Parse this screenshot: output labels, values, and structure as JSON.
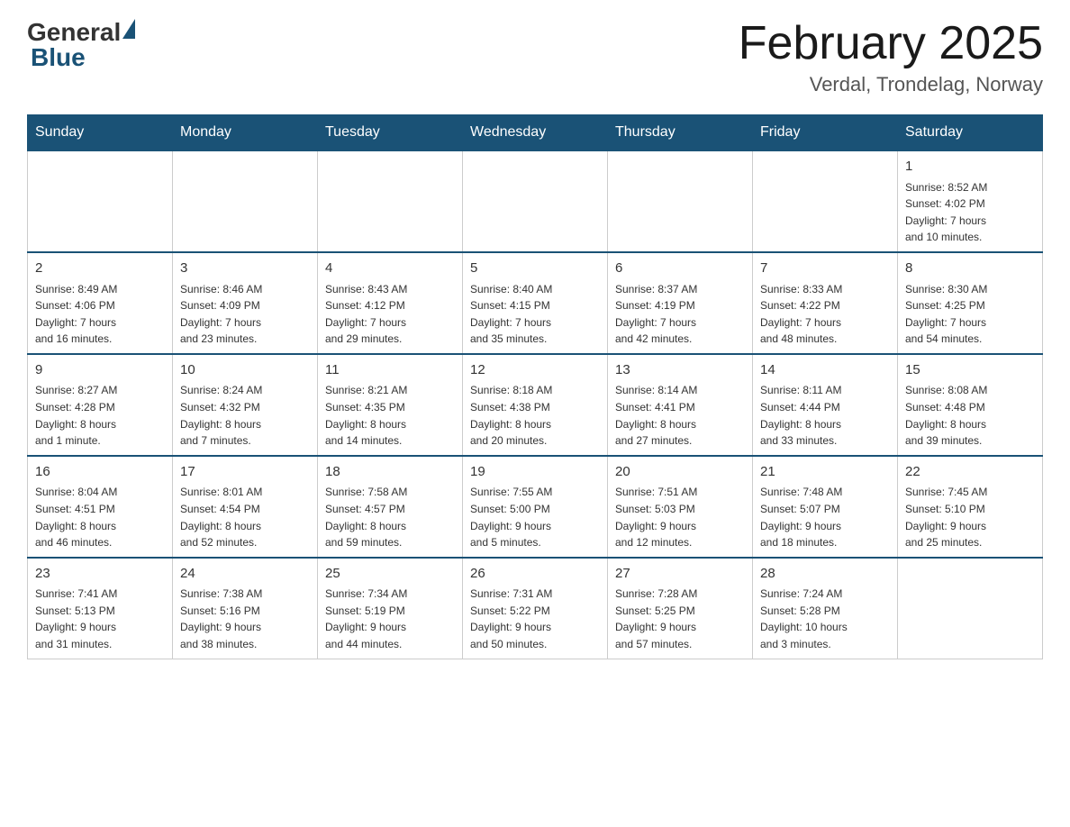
{
  "header": {
    "title": "February 2025",
    "subtitle": "Verdal, Trondelag, Norway",
    "logo": {
      "general": "General",
      "blue": "Blue"
    }
  },
  "weekdays": [
    "Sunday",
    "Monday",
    "Tuesday",
    "Wednesday",
    "Thursday",
    "Friday",
    "Saturday"
  ],
  "weeks": [
    [
      {
        "day": "",
        "info": ""
      },
      {
        "day": "",
        "info": ""
      },
      {
        "day": "",
        "info": ""
      },
      {
        "day": "",
        "info": ""
      },
      {
        "day": "",
        "info": ""
      },
      {
        "day": "",
        "info": ""
      },
      {
        "day": "1",
        "info": "Sunrise: 8:52 AM\nSunset: 4:02 PM\nDaylight: 7 hours\nand 10 minutes."
      }
    ],
    [
      {
        "day": "2",
        "info": "Sunrise: 8:49 AM\nSunset: 4:06 PM\nDaylight: 7 hours\nand 16 minutes."
      },
      {
        "day": "3",
        "info": "Sunrise: 8:46 AM\nSunset: 4:09 PM\nDaylight: 7 hours\nand 23 minutes."
      },
      {
        "day": "4",
        "info": "Sunrise: 8:43 AM\nSunset: 4:12 PM\nDaylight: 7 hours\nand 29 minutes."
      },
      {
        "day": "5",
        "info": "Sunrise: 8:40 AM\nSunset: 4:15 PM\nDaylight: 7 hours\nand 35 minutes."
      },
      {
        "day": "6",
        "info": "Sunrise: 8:37 AM\nSunset: 4:19 PM\nDaylight: 7 hours\nand 42 minutes."
      },
      {
        "day": "7",
        "info": "Sunrise: 8:33 AM\nSunset: 4:22 PM\nDaylight: 7 hours\nand 48 minutes."
      },
      {
        "day": "8",
        "info": "Sunrise: 8:30 AM\nSunset: 4:25 PM\nDaylight: 7 hours\nand 54 minutes."
      }
    ],
    [
      {
        "day": "9",
        "info": "Sunrise: 8:27 AM\nSunset: 4:28 PM\nDaylight: 8 hours\nand 1 minute."
      },
      {
        "day": "10",
        "info": "Sunrise: 8:24 AM\nSunset: 4:32 PM\nDaylight: 8 hours\nand 7 minutes."
      },
      {
        "day": "11",
        "info": "Sunrise: 8:21 AM\nSunset: 4:35 PM\nDaylight: 8 hours\nand 14 minutes."
      },
      {
        "day": "12",
        "info": "Sunrise: 8:18 AM\nSunset: 4:38 PM\nDaylight: 8 hours\nand 20 minutes."
      },
      {
        "day": "13",
        "info": "Sunrise: 8:14 AM\nSunset: 4:41 PM\nDaylight: 8 hours\nand 27 minutes."
      },
      {
        "day": "14",
        "info": "Sunrise: 8:11 AM\nSunset: 4:44 PM\nDaylight: 8 hours\nand 33 minutes."
      },
      {
        "day": "15",
        "info": "Sunrise: 8:08 AM\nSunset: 4:48 PM\nDaylight: 8 hours\nand 39 minutes."
      }
    ],
    [
      {
        "day": "16",
        "info": "Sunrise: 8:04 AM\nSunset: 4:51 PM\nDaylight: 8 hours\nand 46 minutes."
      },
      {
        "day": "17",
        "info": "Sunrise: 8:01 AM\nSunset: 4:54 PM\nDaylight: 8 hours\nand 52 minutes."
      },
      {
        "day": "18",
        "info": "Sunrise: 7:58 AM\nSunset: 4:57 PM\nDaylight: 8 hours\nand 59 minutes."
      },
      {
        "day": "19",
        "info": "Sunrise: 7:55 AM\nSunset: 5:00 PM\nDaylight: 9 hours\nand 5 minutes."
      },
      {
        "day": "20",
        "info": "Sunrise: 7:51 AM\nSunset: 5:03 PM\nDaylight: 9 hours\nand 12 minutes."
      },
      {
        "day": "21",
        "info": "Sunrise: 7:48 AM\nSunset: 5:07 PM\nDaylight: 9 hours\nand 18 minutes."
      },
      {
        "day": "22",
        "info": "Sunrise: 7:45 AM\nSunset: 5:10 PM\nDaylight: 9 hours\nand 25 minutes."
      }
    ],
    [
      {
        "day": "23",
        "info": "Sunrise: 7:41 AM\nSunset: 5:13 PM\nDaylight: 9 hours\nand 31 minutes."
      },
      {
        "day": "24",
        "info": "Sunrise: 7:38 AM\nSunset: 5:16 PM\nDaylight: 9 hours\nand 38 minutes."
      },
      {
        "day": "25",
        "info": "Sunrise: 7:34 AM\nSunset: 5:19 PM\nDaylight: 9 hours\nand 44 minutes."
      },
      {
        "day": "26",
        "info": "Sunrise: 7:31 AM\nSunset: 5:22 PM\nDaylight: 9 hours\nand 50 minutes."
      },
      {
        "day": "27",
        "info": "Sunrise: 7:28 AM\nSunset: 5:25 PM\nDaylight: 9 hours\nand 57 minutes."
      },
      {
        "day": "28",
        "info": "Sunrise: 7:24 AM\nSunset: 5:28 PM\nDaylight: 10 hours\nand 3 minutes."
      },
      {
        "day": "",
        "info": ""
      }
    ]
  ]
}
